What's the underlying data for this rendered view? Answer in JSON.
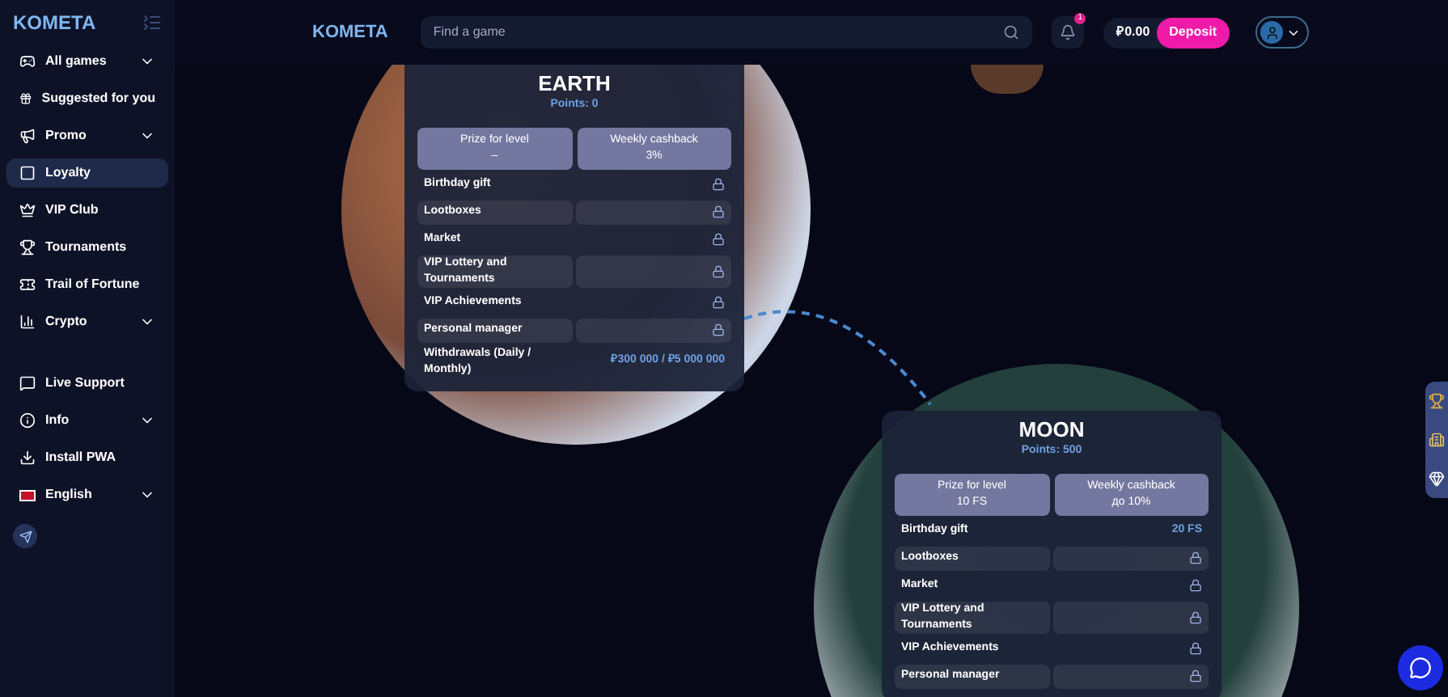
{
  "sidebar": {
    "logo": "KOMETA",
    "items": [
      {
        "label": "All games",
        "selected": false,
        "expandable": true
      },
      {
        "label": "Suggested for you",
        "selected": false,
        "expandable": false
      },
      {
        "label": "Promo",
        "selected": false,
        "expandable": true
      },
      {
        "label": "Loyalty",
        "selected": true,
        "expandable": false
      },
      {
        "label": "VIP Club",
        "selected": false,
        "expandable": false
      },
      {
        "label": "Tournaments",
        "selected": false,
        "expandable": false
      },
      {
        "label": "Trail of Fortune",
        "selected": false,
        "expandable": false
      },
      {
        "label": "Crypto",
        "selected": false,
        "expandable": true
      }
    ],
    "bottom_items": [
      {
        "label": "Live Support",
        "selected": false,
        "expandable": false
      },
      {
        "label": "Info",
        "selected": false,
        "expandable": true
      },
      {
        "label": "Install PWA",
        "selected": false,
        "expandable": false
      },
      {
        "label": "English",
        "selected": false,
        "expandable": true
      }
    ]
  },
  "header": {
    "logo": "KOMETA",
    "search": {
      "placeholder": "Find a game"
    },
    "notifications": "1",
    "balance": "₽0.00",
    "deposit": "Deposit"
  },
  "levels": [
    {
      "name": "EARTH",
      "points": "Points: 0",
      "prize_label": "Prize for level",
      "prize_value": "–",
      "cashback_label": "Weekly cashback",
      "cashback_value": "3%",
      "rows": [
        {
          "label": "Birthday gift",
          "kind": "locked"
        },
        {
          "label": "Lootboxes",
          "kind": "locked"
        },
        {
          "label": "Market",
          "kind": "locked"
        },
        {
          "label": "VIP Lottery and Tournaments",
          "kind": "locked"
        },
        {
          "label": "VIP Achievements",
          "kind": "locked"
        },
        {
          "label": "Personal manager",
          "kind": "locked"
        },
        {
          "label": "Withdrawals (Daily / Monthly)",
          "kind": "value",
          "value": "₽300 000 / ₽5 000 000"
        }
      ]
    },
    {
      "name": "MOON",
      "points": "Points: 500",
      "prize_label": "Prize for level",
      "prize_value": "10 FS",
      "cashback_label": "Weekly cashback",
      "cashback_value": "до 10%",
      "rows": [
        {
          "label": "Birthday gift",
          "kind": "value",
          "value": "20 FS"
        },
        {
          "label": "Lootboxes",
          "kind": "locked"
        },
        {
          "label": "Market",
          "kind": "locked"
        },
        {
          "label": "VIP Lottery and Tournaments",
          "kind": "locked"
        },
        {
          "label": "VIP Achievements",
          "kind": "locked"
        },
        {
          "label": "Personal manager",
          "kind": "locked"
        }
      ]
    }
  ]
}
